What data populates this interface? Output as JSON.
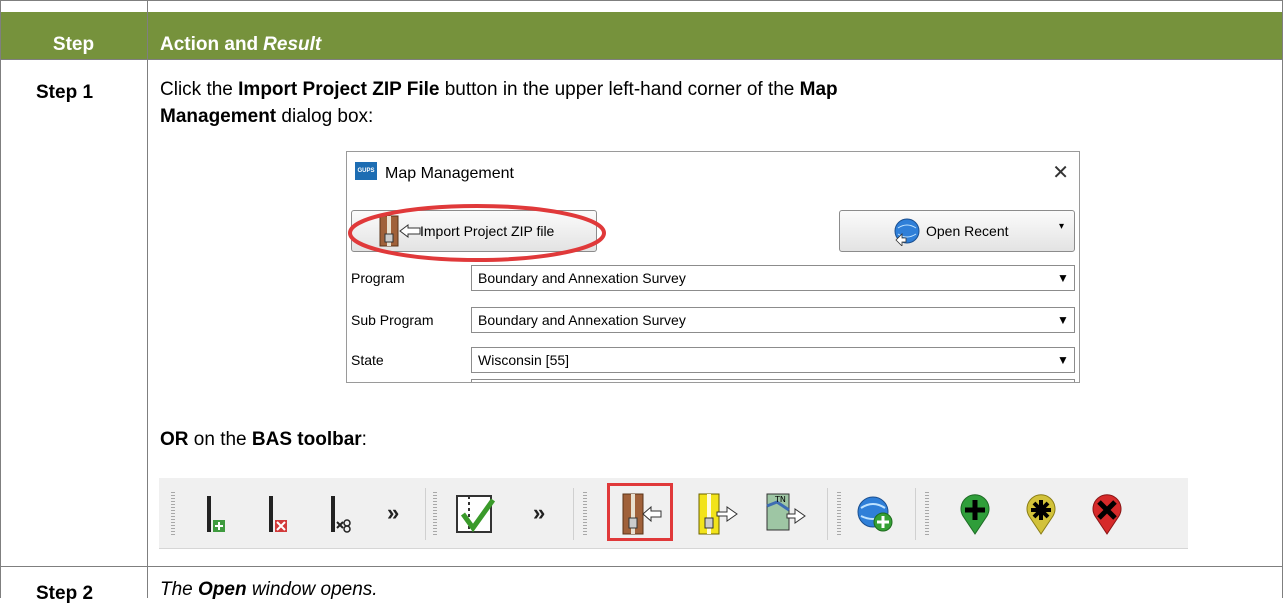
{
  "table": {
    "header": {
      "step": "Step",
      "action_prefix": "Action and",
      "action_italic": "Result"
    },
    "rows": [
      {
        "step": "Step 1",
        "line1_pre": "Click the ",
        "line1_bold1": "Import Project ZIP File",
        "line1_mid": " button in the upper left-hand corner of the ",
        "line1_bold2": "Map",
        "line2_bold": "Management",
        "line2_post": " dialog box:",
        "or_bold": "OR",
        "or_mid": " on the ",
        "or_bold2": "BAS toolbar",
        "or_post": ":"
      },
      {
        "step": "Step 2",
        "pre_italic": "The ",
        "bold_italic": "Open",
        "post_italic": " window opens."
      }
    ]
  },
  "dialog": {
    "logo_text": "GUPS",
    "title": "Map Management",
    "close_glyph": "✕",
    "import_button": "Import Project ZIP file",
    "open_recent_button": "Open Recent",
    "rows": [
      {
        "label": "Program",
        "value": "Boundary and Annexation Survey"
      },
      {
        "label": "Sub Program",
        "value": "Boundary and Annexation Survey"
      },
      {
        "label": "State",
        "value": "Wisconsin [55]"
      }
    ],
    "dropdown_glyph": "⌄"
  },
  "toolbar": {
    "icons": [
      "add-line-icon",
      "delete-line-icon",
      "split-line-icon",
      "validate-check-icon",
      "import-zip-icon",
      "export-zip-icon",
      "export-map-icon",
      "add-web-service-icon",
      "add-point-icon",
      "modify-point-icon",
      "delete-point-icon"
    ],
    "overflow_glyph": "»",
    "highlight_color": "#e0393a"
  },
  "colors": {
    "header_bg": "#76923c",
    "header_text": "#ffffff",
    "annotation": "#e0393a"
  }
}
